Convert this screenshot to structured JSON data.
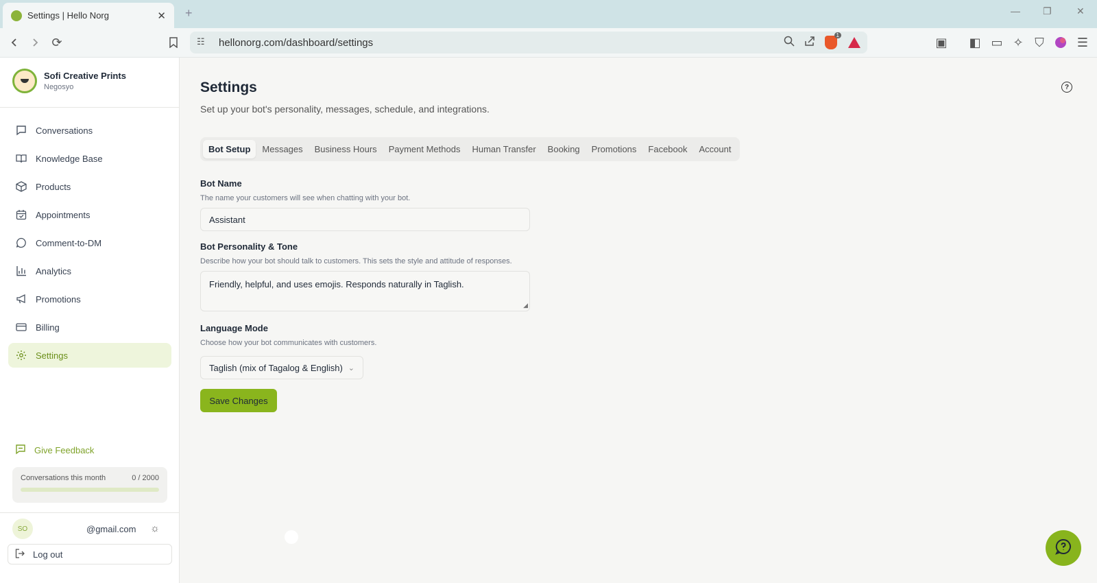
{
  "browser": {
    "tab_title": "Settings | Hello Norg",
    "new_tab": "+",
    "url": "hellonorg.com/dashboard/settings",
    "brave_badge": "1"
  },
  "brand": {
    "name": "Sofi Creative Prints",
    "subtitle": "Negosyo",
    "accent": "#8ab51d"
  },
  "sidebar": {
    "items": [
      {
        "label": "Conversations",
        "icon": "message-square-icon"
      },
      {
        "label": "Knowledge Base",
        "icon": "book-open-icon"
      },
      {
        "label": "Products",
        "icon": "package-icon"
      },
      {
        "label": "Appointments",
        "icon": "calendar-check-icon"
      },
      {
        "label": "Comment-to-DM",
        "icon": "message-circle-icon"
      },
      {
        "label": "Analytics",
        "icon": "bar-chart-icon"
      },
      {
        "label": "Promotions",
        "icon": "megaphone-icon"
      },
      {
        "label": "Billing",
        "icon": "credit-card-icon"
      },
      {
        "label": "Settings",
        "icon": "gear-icon",
        "active": true
      }
    ],
    "feedback": "Give Feedback",
    "usage": {
      "label": "Conversations this month",
      "value": "0 / 2000",
      "fraction": 0.0
    },
    "user": {
      "initials": "SO",
      "email": "@gmail.com"
    },
    "logout": "Log out"
  },
  "main": {
    "title": "Settings",
    "subtitle": "Set up your bot's personality, messages, schedule, and integrations.",
    "tabs": [
      "Bot Setup",
      "Messages",
      "Business Hours",
      "Payment Methods",
      "Human Transfer",
      "Booking",
      "Promotions",
      "Facebook",
      "Account"
    ],
    "active_tab": "Bot Setup",
    "bot_name": {
      "label": "Bot Name",
      "hint": "The name your customers will see when chatting with your bot.",
      "value": "Assistant"
    },
    "personality": {
      "label": "Bot Personality & Tone",
      "hint": "Describe how your bot should talk to customers. This sets the style and attitude of responses.",
      "value": "Friendly, helpful, and uses emojis. Responds naturally in Taglish."
    },
    "language": {
      "label": "Language Mode",
      "hint": "Choose how your bot communicates with customers.",
      "selected": "Taglish (mix of Tagalog & English)"
    },
    "save_label": "Save Changes"
  }
}
